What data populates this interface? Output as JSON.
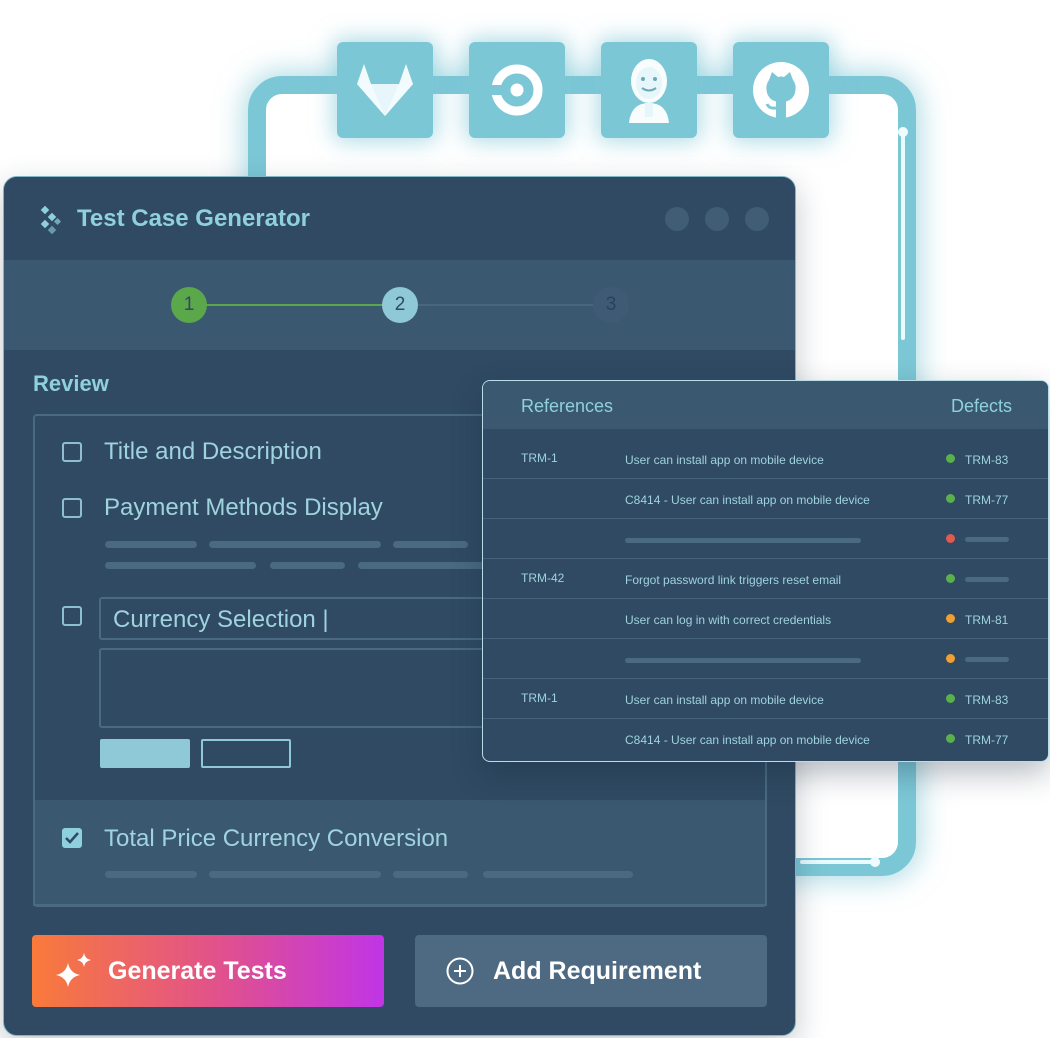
{
  "app": {
    "title": "Test Case Generator"
  },
  "integrations": [
    {
      "name": "gitlab-icon"
    },
    {
      "name": "circleci-icon"
    },
    {
      "name": "jenkins-icon"
    },
    {
      "name": "github-icon"
    }
  ],
  "stepper": {
    "steps": [
      {
        "label": "1",
        "state": "complete"
      },
      {
        "label": "2",
        "state": "current"
      },
      {
        "label": "3",
        "state": "upcoming"
      }
    ]
  },
  "review": {
    "heading": "Review",
    "items": [
      {
        "label": "Title and Description",
        "checked": false
      },
      {
        "label": "Payment Methods Display",
        "checked": false
      },
      {
        "label": "Currency Selection |",
        "checked": false
      },
      {
        "label": "Total Price Currency Conversion",
        "checked": true
      }
    ]
  },
  "actions": {
    "generate_label": "Generate Tests",
    "add_label": "Add Requirement"
  },
  "references": {
    "col_references": "References",
    "col_defects": "Defects",
    "rows": [
      {
        "id": "TRM-1",
        "desc": "User can install app on mobile device",
        "status": "green",
        "defect": "TRM-83"
      },
      {
        "id": "",
        "desc": "C8414 - User can install app on mobile device",
        "status": "green",
        "defect": "TRM-77"
      },
      {
        "id": "",
        "desc": "",
        "status": "red",
        "defect": ""
      },
      {
        "id": "TRM-42",
        "desc": "Forgot password link triggers reset email",
        "status": "green",
        "defect": ""
      },
      {
        "id": "",
        "desc": "User can log in with correct credentials",
        "status": "orange",
        "defect": "TRM-81"
      },
      {
        "id": "",
        "desc": "",
        "status": "orange",
        "defect": ""
      },
      {
        "id": "TRM-1",
        "desc": "User can install app on mobile device",
        "status": "green",
        "defect": "TRM-83"
      },
      {
        "id": "",
        "desc": "C8414 - User can install app on mobile device",
        "status": "green",
        "defect": "TRM-77"
      }
    ]
  },
  "colors": {
    "accent": "#8fd0df",
    "status_green": "#5ab04a",
    "status_orange": "#f0a030",
    "status_red": "#e05a50",
    "step_complete": "#5aa84a",
    "step_current": "#8fc8d7",
    "step_upcoming": "#4a6580",
    "gradient_start": "#f97a3a",
    "gradient_end": "#c035e6"
  }
}
